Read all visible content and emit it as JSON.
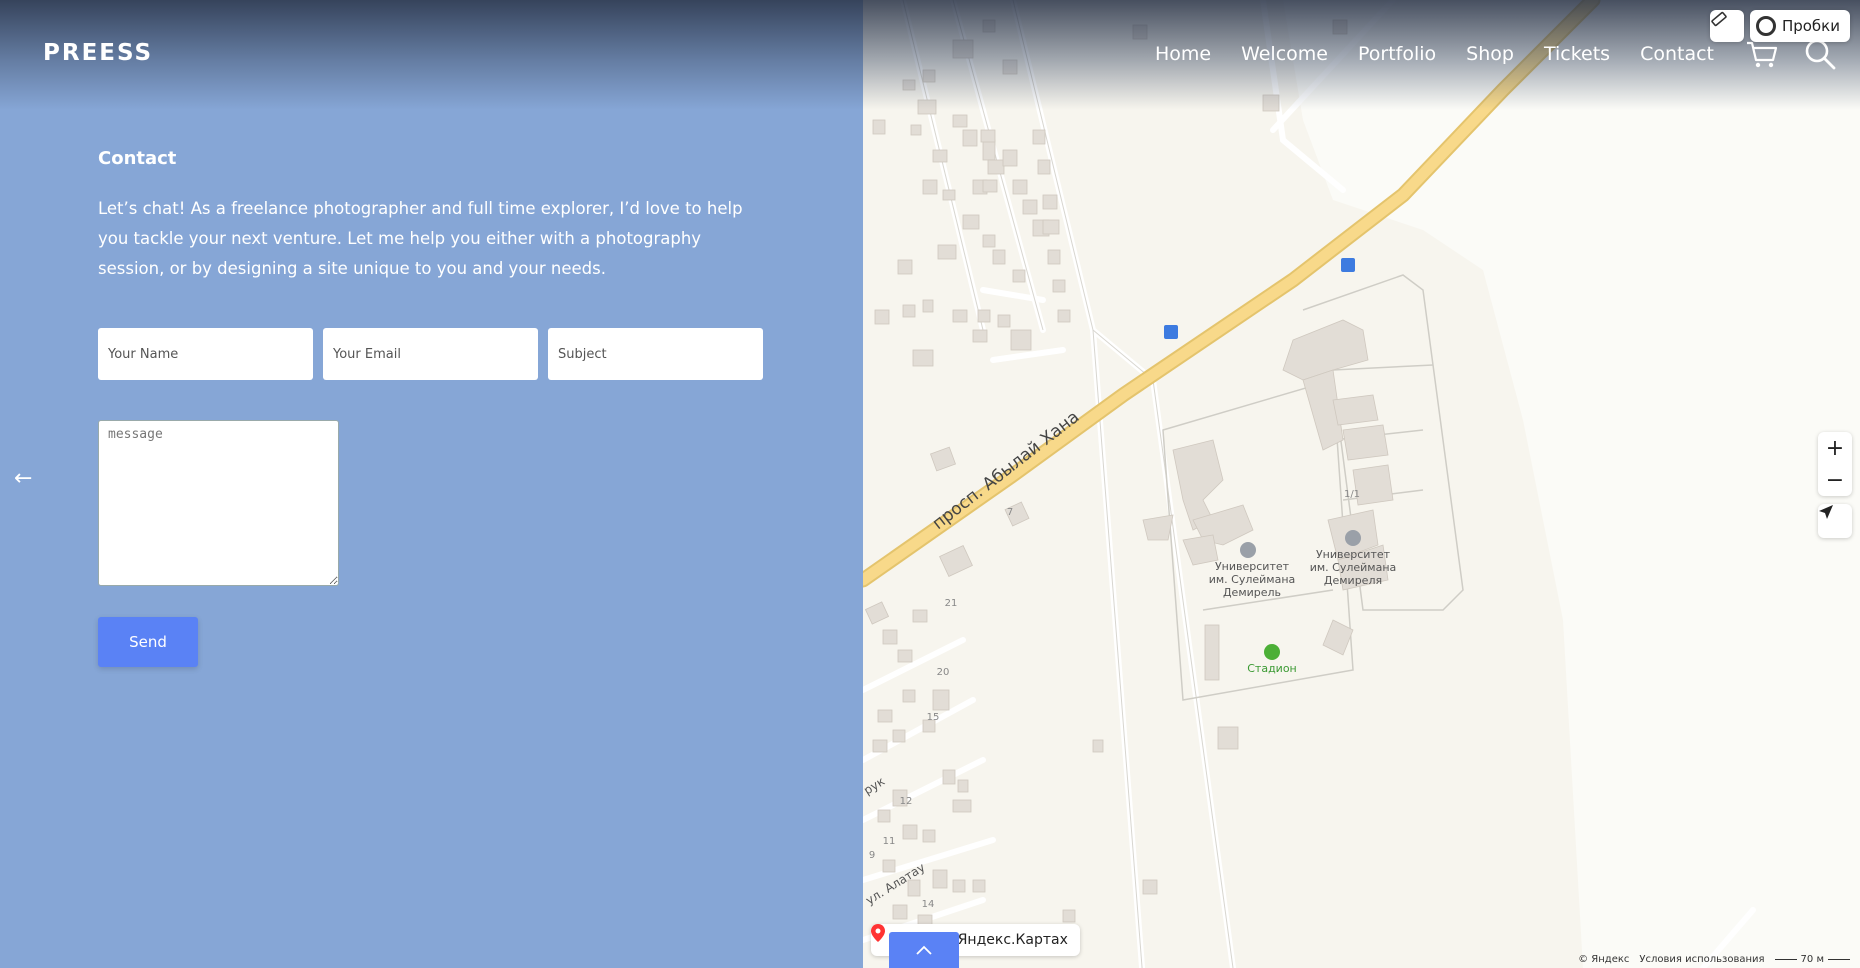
{
  "header": {
    "logo": "PREESS",
    "nav": [
      "Home",
      "Welcome",
      "Portfolio",
      "Shop",
      "Tickets",
      "Contact"
    ]
  },
  "contact": {
    "title": "Contact",
    "intro": "Let’s chat! As a freelance photographer and full time explorer, I’d love to help you tackle your next venture. Let me help you either with a photography session, or by designing a site unique to you and your needs.",
    "name_placeholder": "Your Name",
    "email_placeholder": "Your Email",
    "subject_placeholder": "Subject",
    "message_placeholder": "message",
    "send_label": "Send"
  },
  "map": {
    "traffic_label": "Пробки",
    "zoom_in": "+",
    "zoom_out": "−",
    "street_name": "просп. Абылай Хана",
    "university_1": [
      "Университет",
      "им. Сулеймана",
      "Демирель"
    ],
    "university_2": [
      "Университет",
      "им. Сулеймана",
      "Демиреля"
    ],
    "stadium": "Стадион",
    "building_label": "1/1",
    "house_numbers": [
      "21",
      "20",
      "15",
      "12",
      "11",
      "9",
      "14",
      "7"
    ],
    "street_2": "ул. Алатау",
    "street_3": "рук",
    "open_in": "Открыть в Яндекс.Картах",
    "open_in_visible": "в Яндекс.Картах",
    "copyright": "© Яндекс",
    "terms": "Условия использования",
    "scale": "70 м"
  },
  "colors": {
    "panel_bg": "#86a6d6",
    "button": "#5a82f5",
    "road": "#f8d98a"
  }
}
